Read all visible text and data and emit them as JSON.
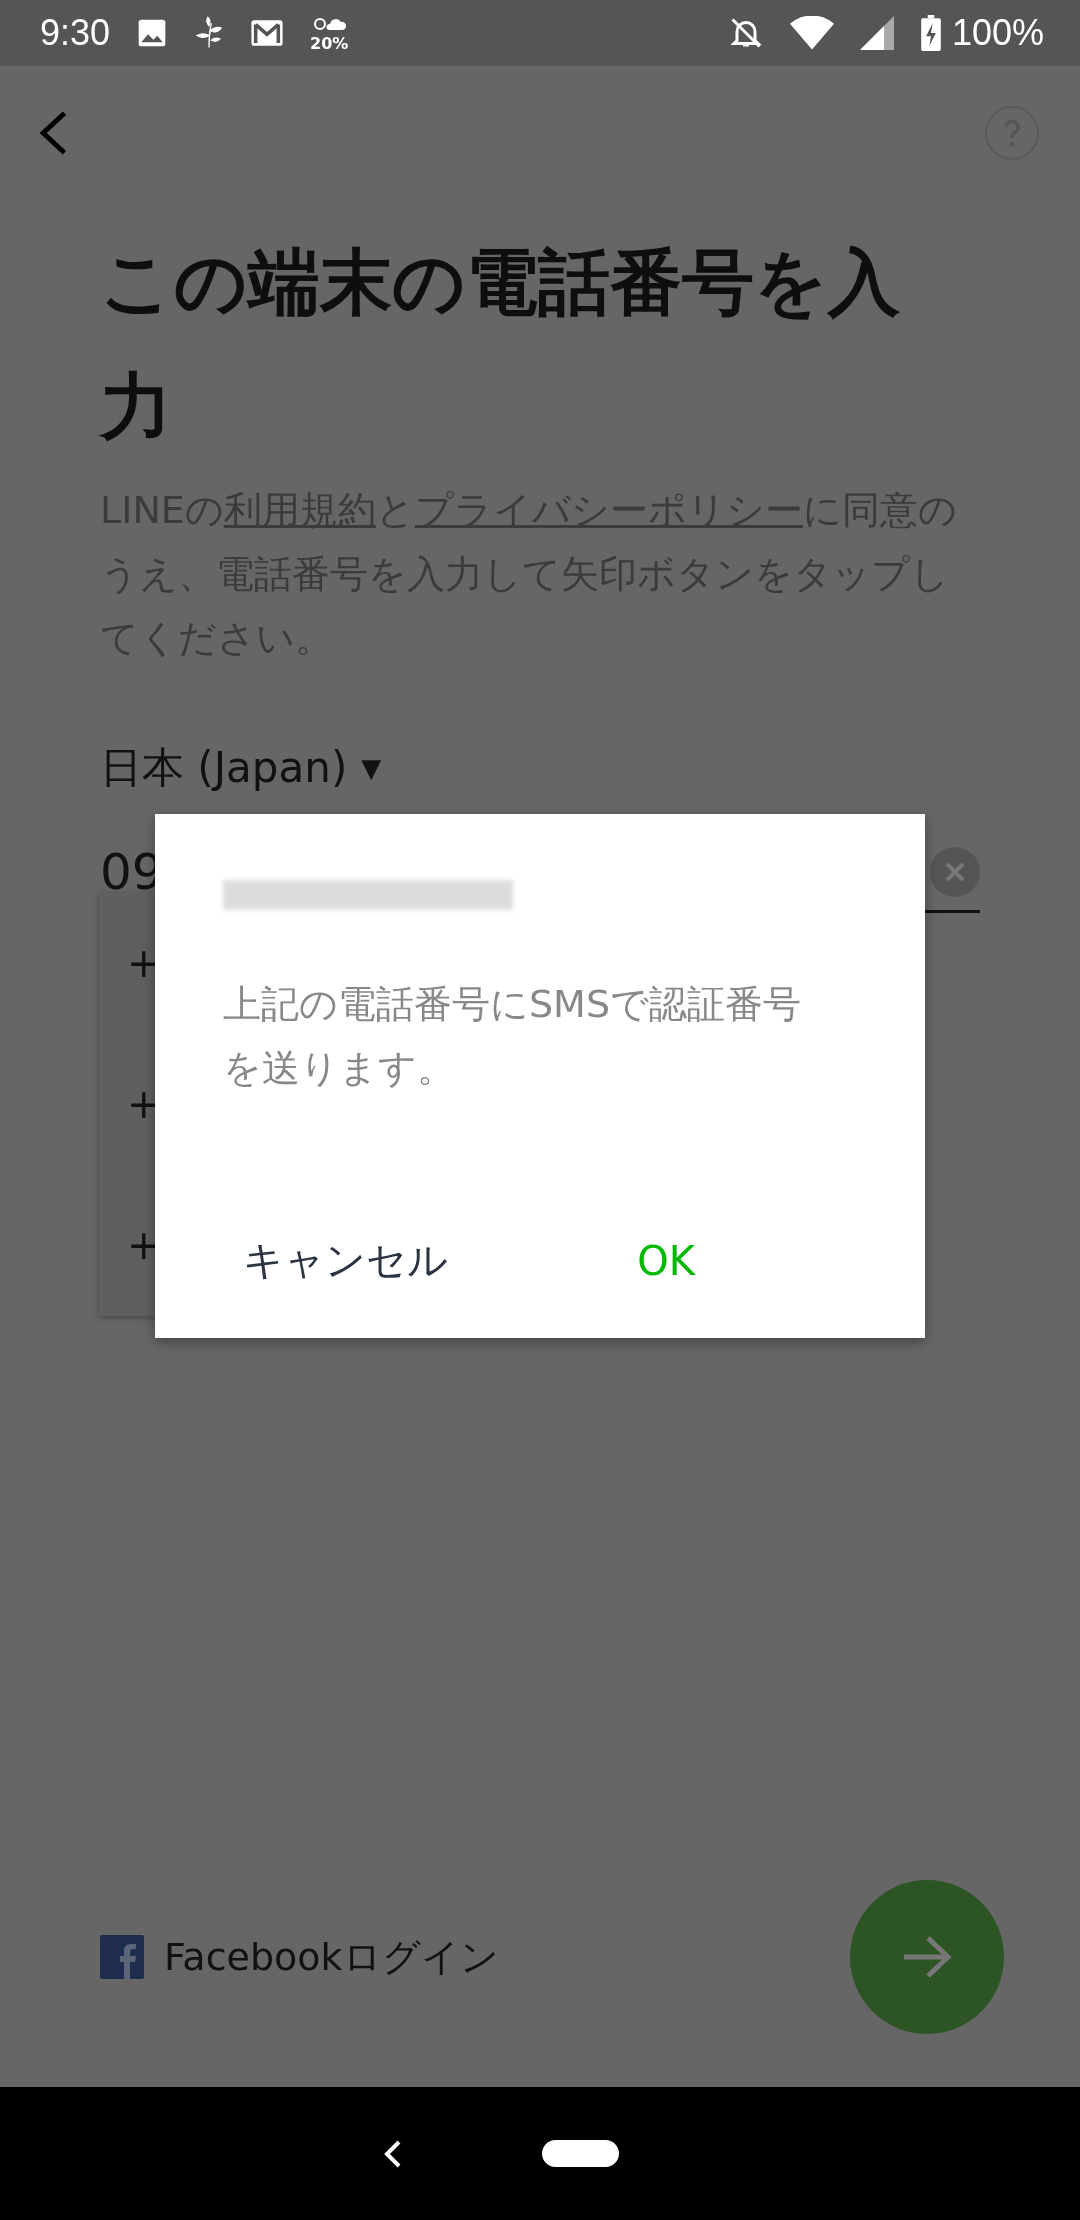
{
  "status_bar": {
    "time": "9:30",
    "weather_text": "20%",
    "battery": "100%"
  },
  "title": "この端末の電話番号を入力",
  "description": [
    {
      "kind": "text",
      "text": "LINEの"
    },
    {
      "kind": "link",
      "text": "利用規約"
    },
    {
      "kind": "text",
      "text": "と"
    },
    {
      "kind": "link",
      "text": "プライバシーポリシー"
    },
    {
      "kind": "text",
      "text": "に同意のうえ、電話番号を入力して矢印ボタンをタップしてください。"
    }
  ],
  "country_selector": {
    "label": "日本 (Japan)",
    "caret": "▼"
  },
  "phone_field": {
    "value": "09"
  },
  "suggestions": [
    "+",
    "+",
    "+"
  ],
  "dialog": {
    "message": "上記の電話番号にSMSで認証番号を送ります。",
    "buttons": [
      {
        "label": "キャンセル",
        "kind": "neutral"
      },
      {
        "label": "OK",
        "kind": "positive"
      }
    ]
  },
  "facebook_login": {
    "label": "Facebookログイン"
  }
}
